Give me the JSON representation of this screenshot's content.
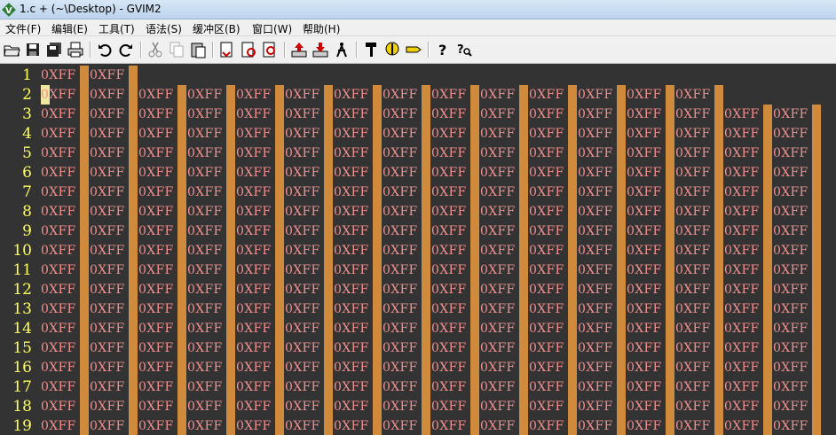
{
  "window": {
    "title": "1.c + (~\\Desktop) - GVIM2",
    "app_icon": "gvim-icon"
  },
  "menu": [
    "文件(F)",
    "编辑(E)",
    "工具(T)",
    "语法(S)",
    "缓冲区(B)",
    "窗口(W)",
    "帮助(H)"
  ],
  "toolbar": [
    "open-icon",
    "save-icon",
    "save-all-icon",
    "print-icon",
    "undo-icon",
    "redo-icon",
    "cut-icon",
    "copy-icon",
    "paste-icon",
    "find-replace-icon",
    "find-next-icon",
    "find-prev-icon",
    "load-session-icon",
    "save-session-icon",
    "run-script-icon",
    "make-icon",
    "shell-icon",
    "tags-icon",
    "help-icon",
    "find-help-icon"
  ],
  "editor": {
    "token_text": "0XFF",
    "comma": ",",
    "colors": {
      "background": "#333333",
      "line_number": "#ffff55",
      "text": "#f08f8f",
      "comma_highlight": "#d08a3c",
      "cursor": "#f0e8a0"
    },
    "lines": [
      {
        "num": "1",
        "tokens": 2
      },
      {
        "num": "2",
        "tokens": 14,
        "cursor": true
      },
      {
        "num": "3",
        "tokens": 16
      },
      {
        "num": "4",
        "tokens": 16
      },
      {
        "num": "5",
        "tokens": 16
      },
      {
        "num": "6",
        "tokens": 16
      },
      {
        "num": "7",
        "tokens": 16
      },
      {
        "num": "8",
        "tokens": 16
      },
      {
        "num": "9",
        "tokens": 16
      },
      {
        "num": "10",
        "tokens": 16
      },
      {
        "num": "11",
        "tokens": 16
      },
      {
        "num": "12",
        "tokens": 16
      },
      {
        "num": "13",
        "tokens": 16
      },
      {
        "num": "14",
        "tokens": 16
      },
      {
        "num": "15",
        "tokens": 16
      },
      {
        "num": "16",
        "tokens": 16
      },
      {
        "num": "17",
        "tokens": 16
      },
      {
        "num": "18",
        "tokens": 16
      },
      {
        "num": "19",
        "tokens": 16
      }
    ]
  }
}
